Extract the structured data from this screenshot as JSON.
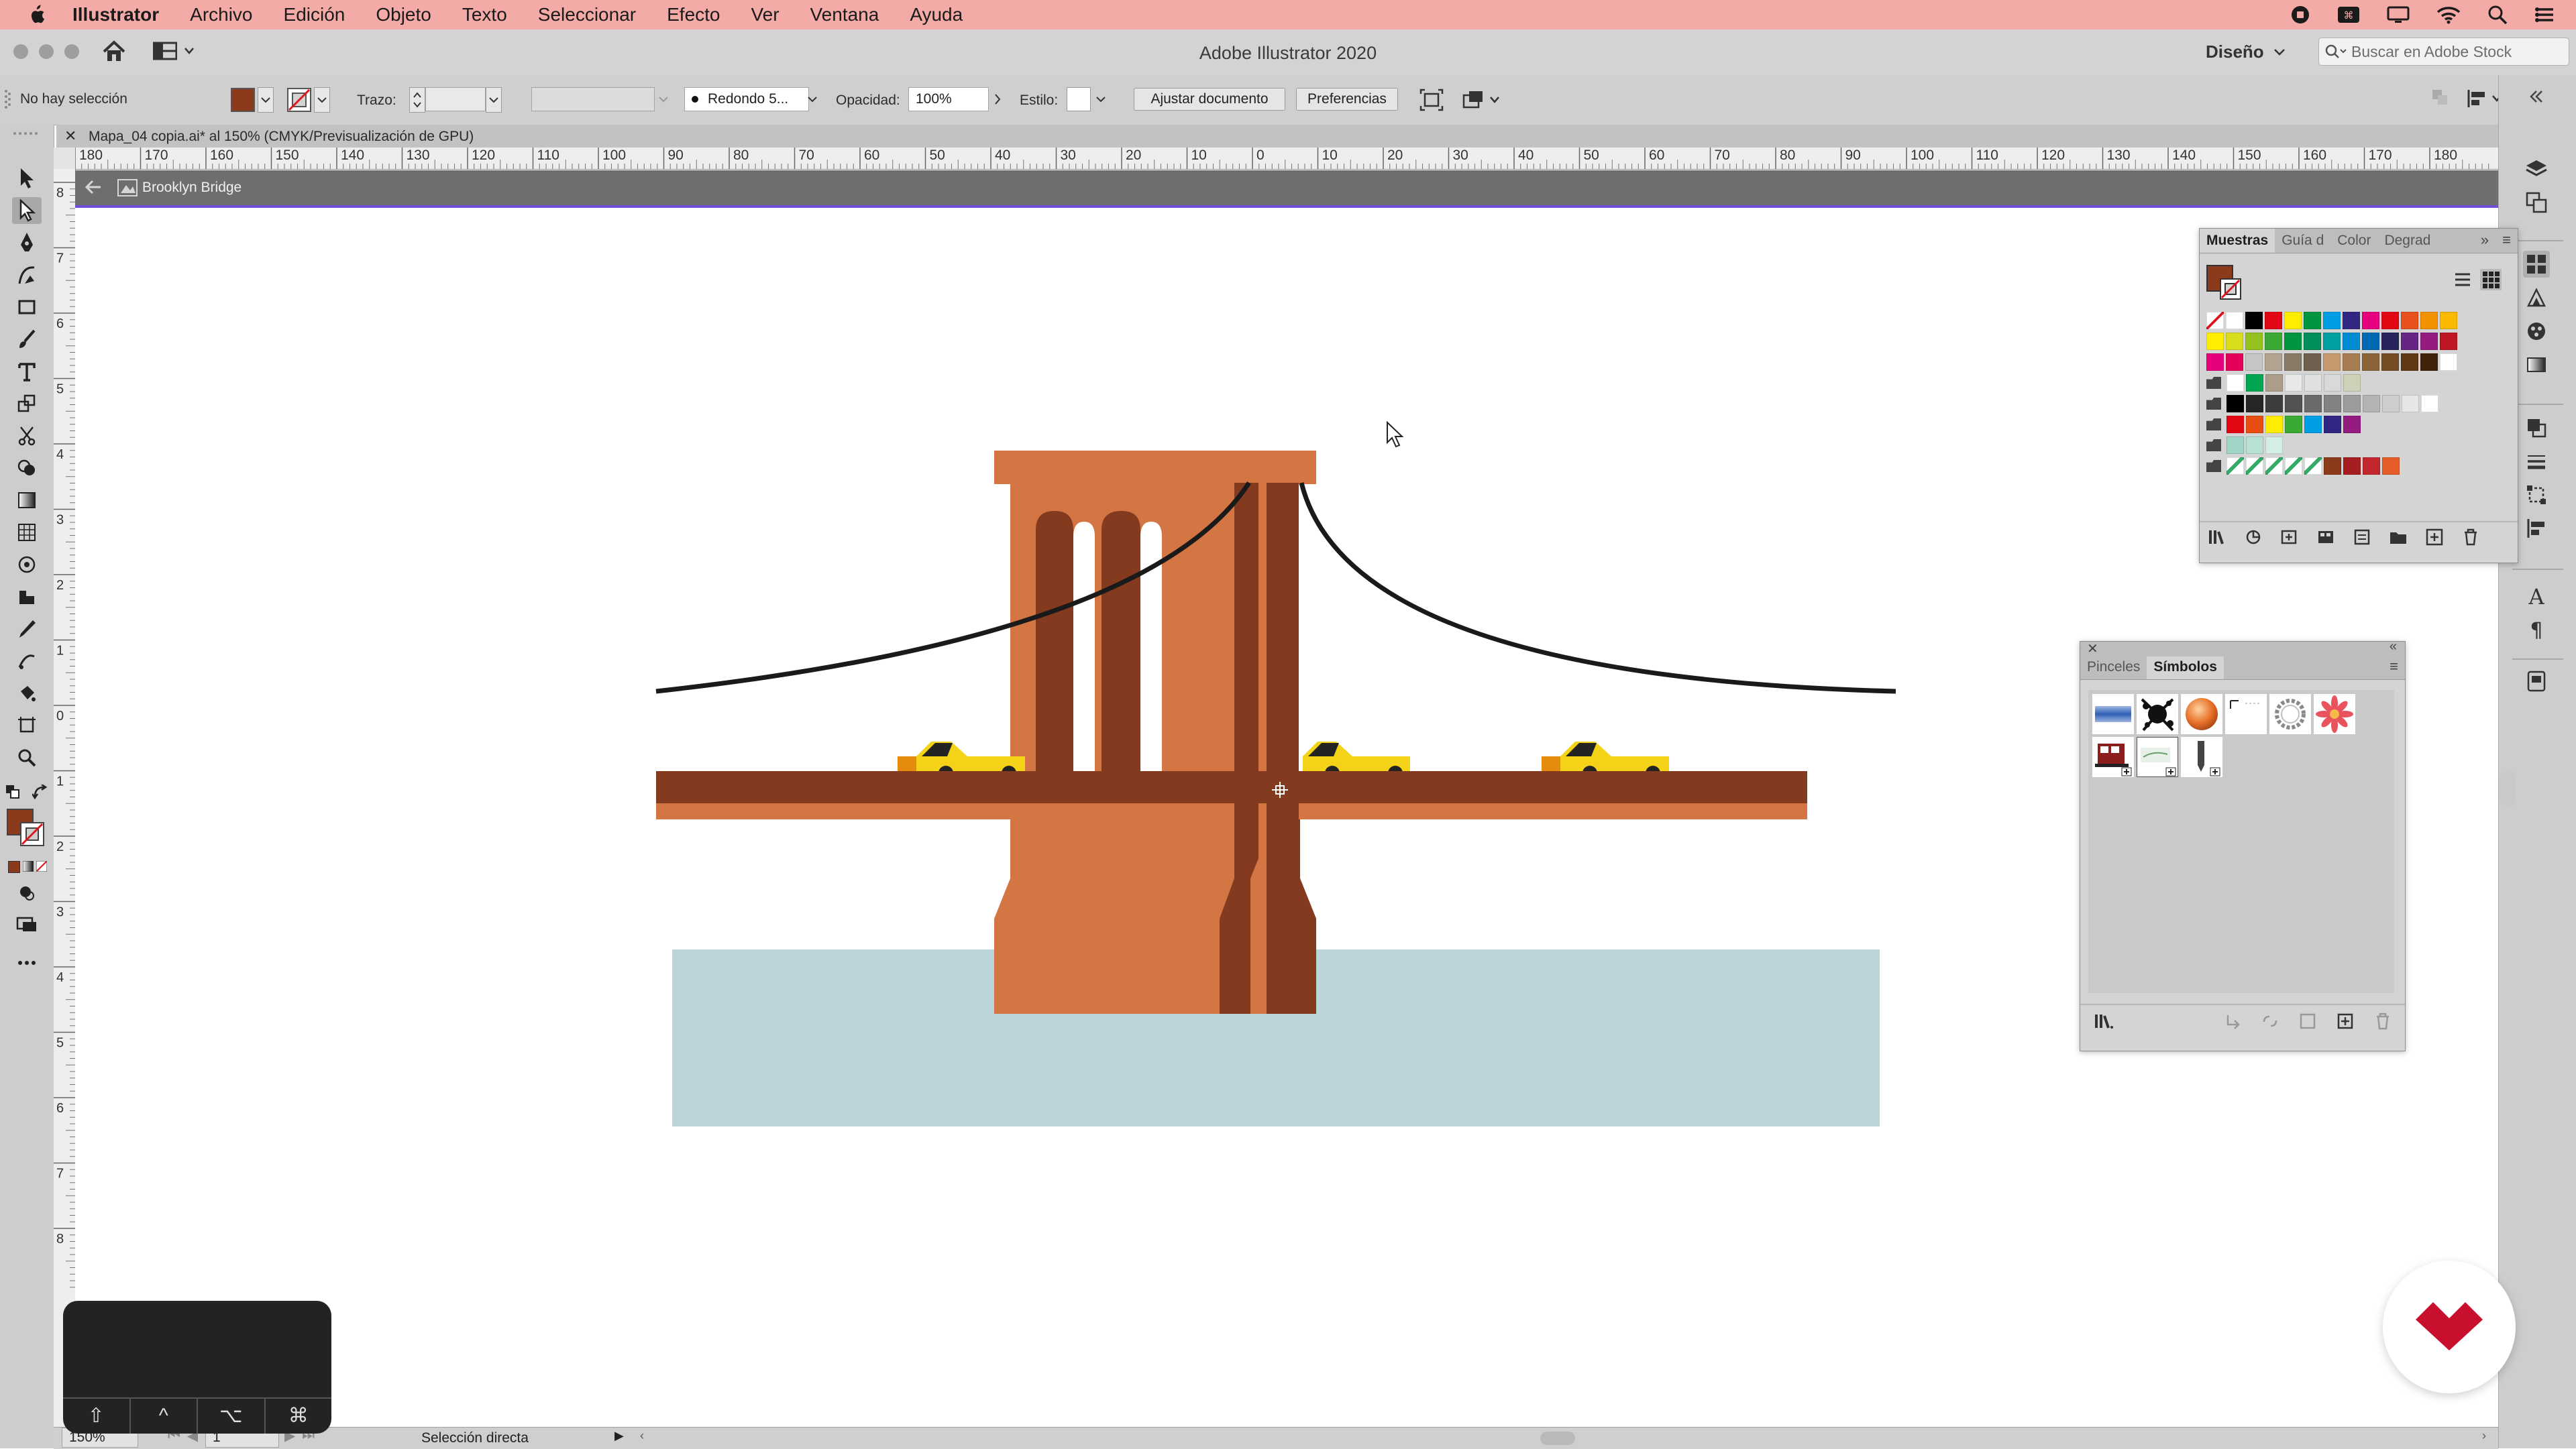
{
  "menubar": {
    "app": "Illustrator",
    "items": [
      "Archivo",
      "Edición",
      "Objeto",
      "Texto",
      "Seleccionar",
      "Efecto",
      "Ver",
      "Ventana",
      "Ayuda"
    ],
    "status_icons": [
      "record-icon",
      "screenshot-icon",
      "display-icon",
      "wifi-icon",
      "spotlight-icon",
      "control-center-icon"
    ]
  },
  "titlebar": {
    "title": "Adobe Illustrator 2020",
    "workspace": "Diseño",
    "search_placeholder": "Buscar en Adobe Stock"
  },
  "controlbar": {
    "selection_status": "No hay selección",
    "fill_color": "#8b3a1c",
    "stroke_label": "Trazo:",
    "brush_profile": "Redondo 5...",
    "opacity_label": "Opacidad:",
    "opacity_value": "100%",
    "style_label": "Estilo:",
    "document_setup_button": "Ajustar documento",
    "preferences_button": "Preferencias"
  },
  "document": {
    "tab_title": "Mapa_04 copia.ai* al 150% (CMYK/Previsualización de GPU)",
    "isolation_group": "Brooklyn Bridge"
  },
  "rulers": {
    "horizontal": [
      "180",
      "170",
      "160",
      "150",
      "140",
      "130",
      "120",
      "110",
      "100",
      "90",
      "80",
      "70",
      "60",
      "50",
      "40",
      "30",
      "20",
      "10",
      "0",
      "10",
      "20",
      "30",
      "40",
      "50",
      "60",
      "70",
      "80",
      "90",
      "100",
      "110",
      "120",
      "130",
      "140",
      "150",
      "160",
      "170",
      "180"
    ],
    "vertical": [
      "8",
      "7",
      "6",
      "5",
      "4",
      "3",
      "2",
      "1",
      "0",
      "1",
      "2",
      "3",
      "4",
      "5",
      "6",
      "7",
      "8"
    ]
  },
  "artwork": {
    "colors": {
      "tower": "#d37643",
      "tower_dark": "#833a1f",
      "deck_top": "#833a1f",
      "deck_bottom": "#d37643",
      "water": "#bcd3d8",
      "cable": "#1a1a1a",
      "taxi": "#f4d218",
      "taxi_front": "#e48a0c",
      "taxi_roof": "#232323"
    }
  },
  "swatches_panel": {
    "tabs": [
      "Muestras",
      "Guía d",
      "Color",
      "Degrad"
    ],
    "rows": [
      [
        "#ffffff",
        "#ffffff",
        "#000000",
        "#e30613",
        "#ffed00",
        "#00963f",
        "#009ee3",
        "#312783",
        "#e6007e",
        "#e30613",
        "#e9521c",
        "#f39200",
        "#fbba00"
      ],
      [
        "#ffed00",
        "#d9de1c",
        "#95c11f",
        "#3aaa35",
        "#009640",
        "#008e5a",
        "#009fa0",
        "#008bd2",
        "#0069b4",
        "#29235c",
        "#662483",
        "#951b81",
        "#be1622"
      ],
      [
        "#e6007e",
        "#e5005a",
        "#c6c6c6",
        "#b2a290",
        "#877a67",
        "#6f5f4e",
        "#c49a6c",
        "#a67c52",
        "#8c6239",
        "#754c24",
        "#603813",
        "#42210b",
        "#ffffff"
      ],
      [
        "#ffffff",
        "#00a650",
        "#ac9d8a",
        "#e8e8e8",
        "#e0e0e0",
        "#d9d9d9",
        "#cfd0b8"
      ],
      [
        "#000000",
        "#262626",
        "#3c3c3c",
        "#525252",
        "#6a6a6a",
        "#828282",
        "#9b9b9b",
        "#b4b4b4",
        "#cdcdcd",
        "#e6e6e6",
        "#ffffff"
      ],
      [
        "#e30613",
        "#e84e0f",
        "#ffed00",
        "#3aaa35",
        "#009ee3",
        "#312783",
        "#951b81"
      ],
      [
        "#a0d6c8",
        "#b7e1d3",
        "#d4eee5"
      ],
      [
        "#ffffff",
        "#ffffff",
        "#ffffff",
        "#ffffff",
        "#ffffff",
        "#8b3a1c",
        "#a61e22",
        "#c1272d",
        "#e45d2b"
      ]
    ]
  },
  "symbols_panel": {
    "tabs": [
      "Pinceles",
      "Símbolos"
    ],
    "symbols": [
      "blue-gradient-symbol",
      "ink-splat-symbol",
      "orange-sphere-symbol",
      "dashed-frame-symbol",
      "laurel-ring-symbol",
      "red-flower-symbol",
      "tram-symbol",
      "map-block-symbol",
      "pencil-symbol"
    ]
  },
  "statusbar": {
    "zoom": "150%",
    "artboard": "1",
    "tool_status": "Selección directa"
  },
  "keycast": {
    "keys": [
      "⇧",
      "^",
      "⌥",
      "⌘"
    ]
  }
}
